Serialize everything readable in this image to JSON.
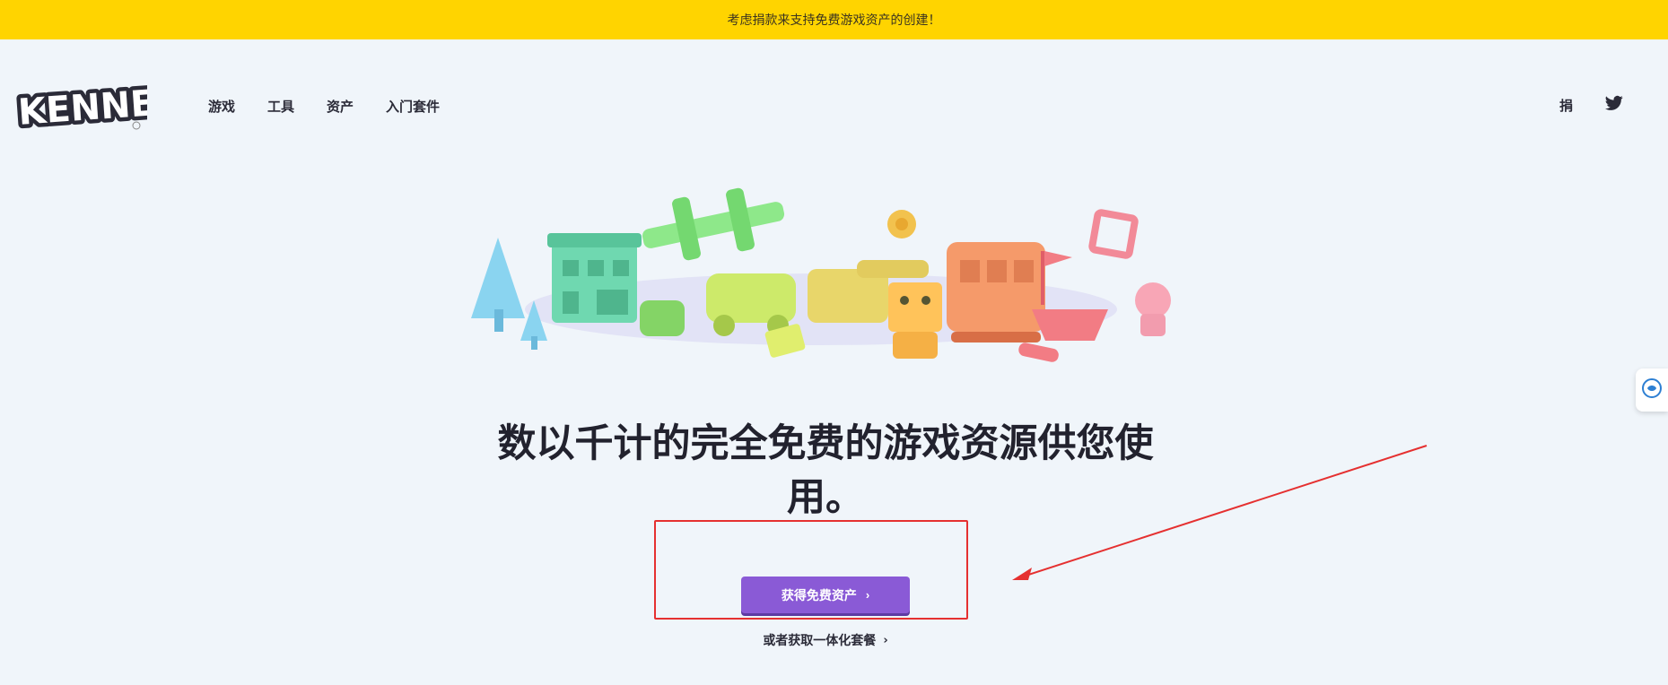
{
  "banner": {
    "text": "考虑捐款来支持免费游戏资产的创建！"
  },
  "logo": {
    "text": "KENNEY"
  },
  "nav": {
    "items": [
      {
        "label": "游戏"
      },
      {
        "label": "工具"
      },
      {
        "label": "资产"
      },
      {
        "label": "入门套件"
      }
    ],
    "donate_label": "捐"
  },
  "hero": {
    "headline": "数以千计的完全免费的游戏资源供您使用。",
    "cta_label": "获得免费资产",
    "bundle_label": "或者获取一体化套餐"
  },
  "icons": {
    "twitter": "twitter-icon",
    "cta_arrow": "chevron-right-icon",
    "bundle_arrow": "chevron-right-icon",
    "side_widget": "translate-icon"
  },
  "colors": {
    "banner": "#ffd400",
    "page_bg": "#f0f5fa",
    "cta": "#8a5ad6",
    "annotation": "#e53030"
  }
}
